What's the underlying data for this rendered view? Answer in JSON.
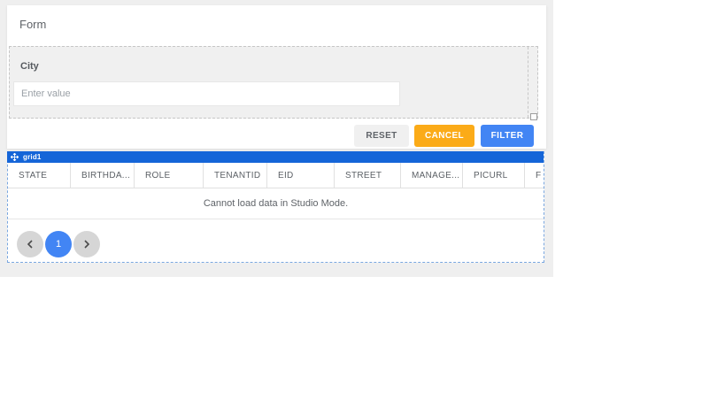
{
  "form": {
    "title": "Form",
    "field": {
      "label": "City",
      "value": "",
      "placeholder": "Enter value"
    },
    "buttons": {
      "reset": "RESET",
      "cancel": "CANCEL",
      "filter": "FILTER"
    }
  },
  "grid": {
    "widget_label": "grid1",
    "columns": [
      "STATE",
      "BIRTHDA...",
      "ROLE",
      "TENANTID",
      "EID",
      "STREET",
      "MANAGE...",
      "PICURL",
      "F"
    ],
    "empty_message": "Cannot load data in Studio Mode.",
    "pagination": {
      "current_page": "1",
      "prev_icon": "chevron-left",
      "next_icon": "chevron-right"
    },
    "drag_icon": "move-arrows"
  },
  "colors": {
    "accent_blue": "#4285f4",
    "accent_amber": "#fbab18",
    "grid_bar_blue": "#1565d8",
    "grid_selection_border": "#7aa7e0",
    "canvas_gray": "#efefef"
  }
}
